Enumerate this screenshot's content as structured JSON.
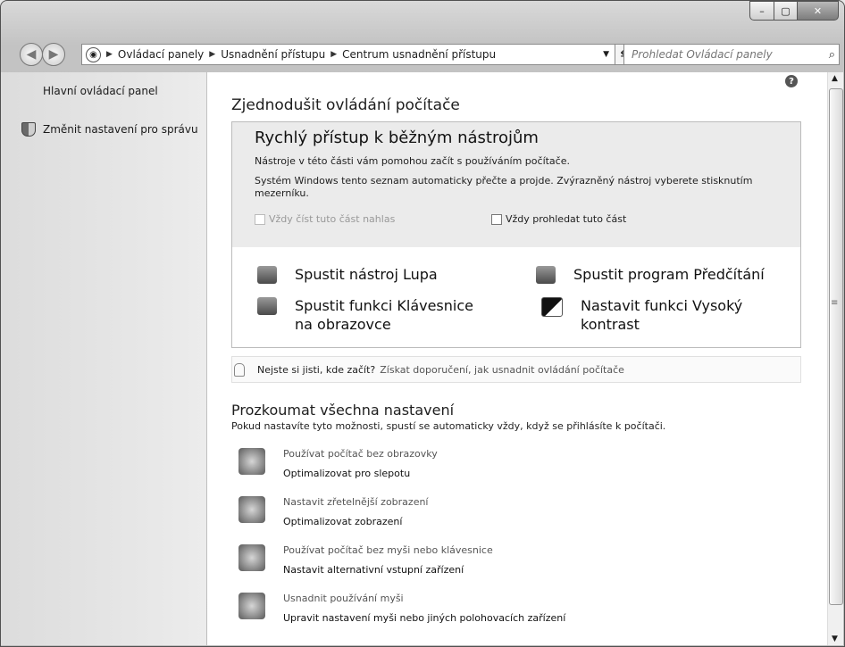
{
  "window": {
    "min_glyph": "–",
    "max_glyph": "▢",
    "close_glyph": "✕"
  },
  "nav": {
    "back_glyph": "◀",
    "forward_glyph": "▶",
    "breadcrumb": [
      "Ovládací panely",
      "Usnadnění přístupu",
      "Centrum usnadnění přístupu"
    ],
    "refresh_glyph": "⇆",
    "search_placeholder": "Prohledat Ovládací panely"
  },
  "sidebar": {
    "items": [
      {
        "label": "Hlavní ovládací panel"
      },
      {
        "label": "Změnit nastavení pro správu"
      }
    ]
  },
  "main": {
    "title": "Zjednodušit ovládání počítače",
    "help_glyph": "?",
    "quick": {
      "heading": "Rychlý přístup k běžným nástrojům",
      "line1": "Nástroje v této části vám pomohou začít s používáním počítače.",
      "line2": "Systém Windows tento seznam automaticky přečte a projde. Zvýrazněný nástroj vyberete stisknutím mezerníku.",
      "checkbox_read": "Vždy číst tuto část nahlas",
      "checkbox_scan": "Vždy prohledat tuto část"
    },
    "tools": [
      {
        "label": "Spustit nástroj Lupa",
        "icon": "magnifier-icon"
      },
      {
        "label": "Spustit program Předčítání",
        "icon": "narrator-icon"
      },
      {
        "label": "Spustit funkci Klávesnice na obrazovce",
        "icon": "keyboard-icon"
      },
      {
        "label": "Nastavit funkci Vysoký kontrast",
        "icon": "contrast-icon"
      }
    ],
    "tip": {
      "question": "Nejste si jisti, kde začít?",
      "link": "Získat doporučení, jak usnadnit ovládání počítače"
    },
    "explore": {
      "heading": "Prozkoumat všechna nastavení",
      "subtitle": "Pokud nastavíte tyto možnosti, spustí se automaticky vždy, když se přihlásíte k počítači.",
      "items": [
        {
          "title": "Používat počítač bez obrazovky",
          "link": "Optimalizovat pro slepotu"
        },
        {
          "title": "Nastavit zřetelnější zobrazení",
          "link": "Optimalizovat zobrazení"
        },
        {
          "title": "Používat počítač bez myši nebo klávesnice",
          "link": "Nastavit alternativní vstupní zařízení"
        },
        {
          "title": "Usnadnit používání myši",
          "link": "Upravit nastavení myši nebo jiných polohovacích zařízení"
        }
      ]
    }
  }
}
